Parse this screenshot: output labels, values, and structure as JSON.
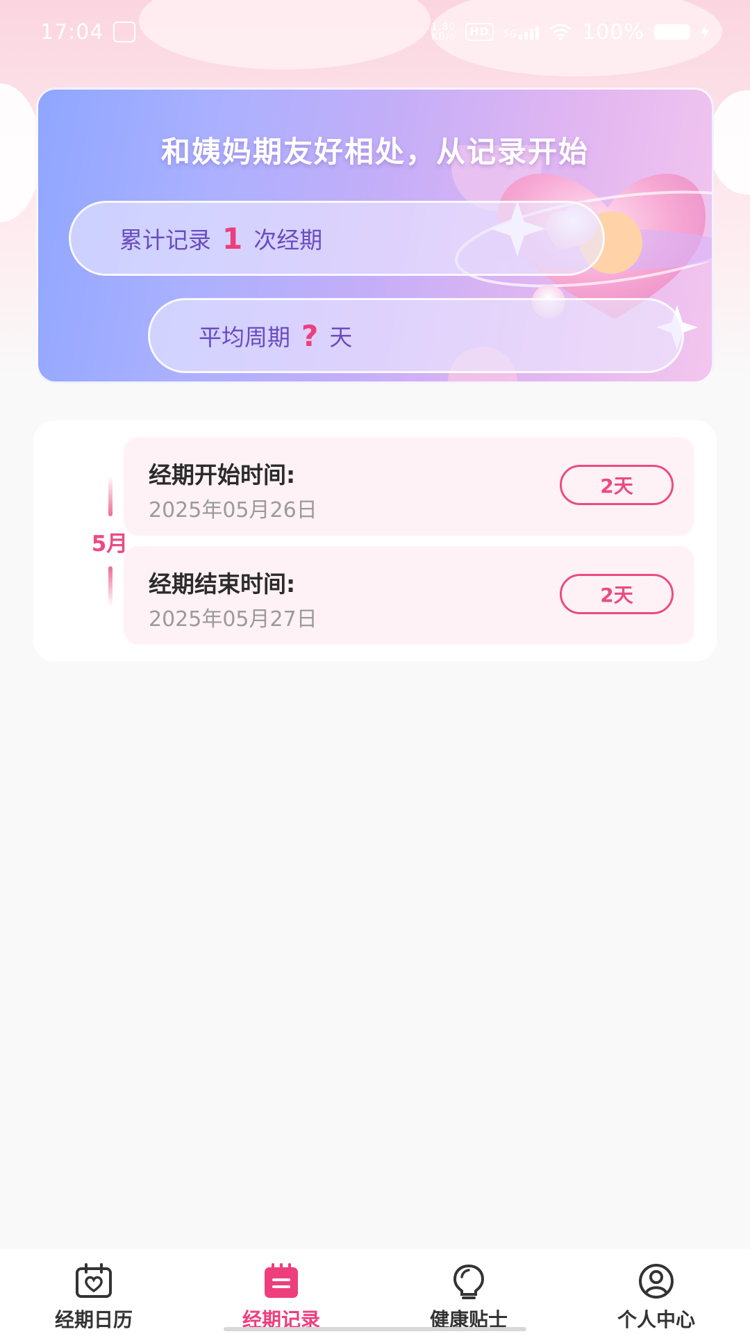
{
  "status_bar": {
    "time": "17:04",
    "net_speed_top": "1.80",
    "net_speed_bottom": "KB/s",
    "hd": "HD",
    "network": "5G",
    "battery": "100%"
  },
  "hero": {
    "title": "和姨妈期友好相处，从记录开始",
    "total_prefix": "累计记录",
    "total_count": "1",
    "total_suffix": "次经期",
    "avg_prefix": "平均周期",
    "avg_value": "?",
    "avg_suffix": "天"
  },
  "records": {
    "month": "5月",
    "items": [
      {
        "title": "经期开始时间:",
        "date": "2025年05月26日",
        "badge": "2天"
      },
      {
        "title": "经期结束时间:",
        "date": "2025年05月27日",
        "badge": "2天"
      }
    ]
  },
  "nav": {
    "items": [
      {
        "label": "经期日历",
        "icon": "calendar-heart-icon",
        "active": false
      },
      {
        "label": "经期记录",
        "icon": "record-notebook-icon",
        "active": true
      },
      {
        "label": "健康贴士",
        "icon": "lightbulb-icon",
        "active": false
      },
      {
        "label": "个人中心",
        "icon": "user-circle-icon",
        "active": false
      }
    ],
    "active_color": "#ee3e7c"
  }
}
